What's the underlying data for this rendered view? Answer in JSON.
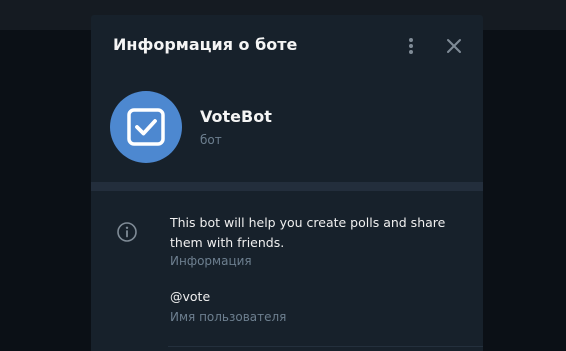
{
  "dialog": {
    "title": "Информация о боте",
    "menu_icon": "more-vertical-icon",
    "close_icon": "close-icon"
  },
  "bot": {
    "avatar_icon": "checkbox-checked-icon",
    "avatar_color": "#4d88d0",
    "name": "VoteBot",
    "status": "бот"
  },
  "details": {
    "info_icon": "info-icon",
    "about_text": "This bot will help you create polls and share them with friends.",
    "about_label": "Информация",
    "username": "@vote",
    "username_label": "Имя пользователя"
  },
  "colors": {
    "panel": "#17212b",
    "divider": "#232e3c",
    "text_primary": "#f5f5f5",
    "text_secondary": "#6d7f8f",
    "icon": "#7f8b96"
  }
}
